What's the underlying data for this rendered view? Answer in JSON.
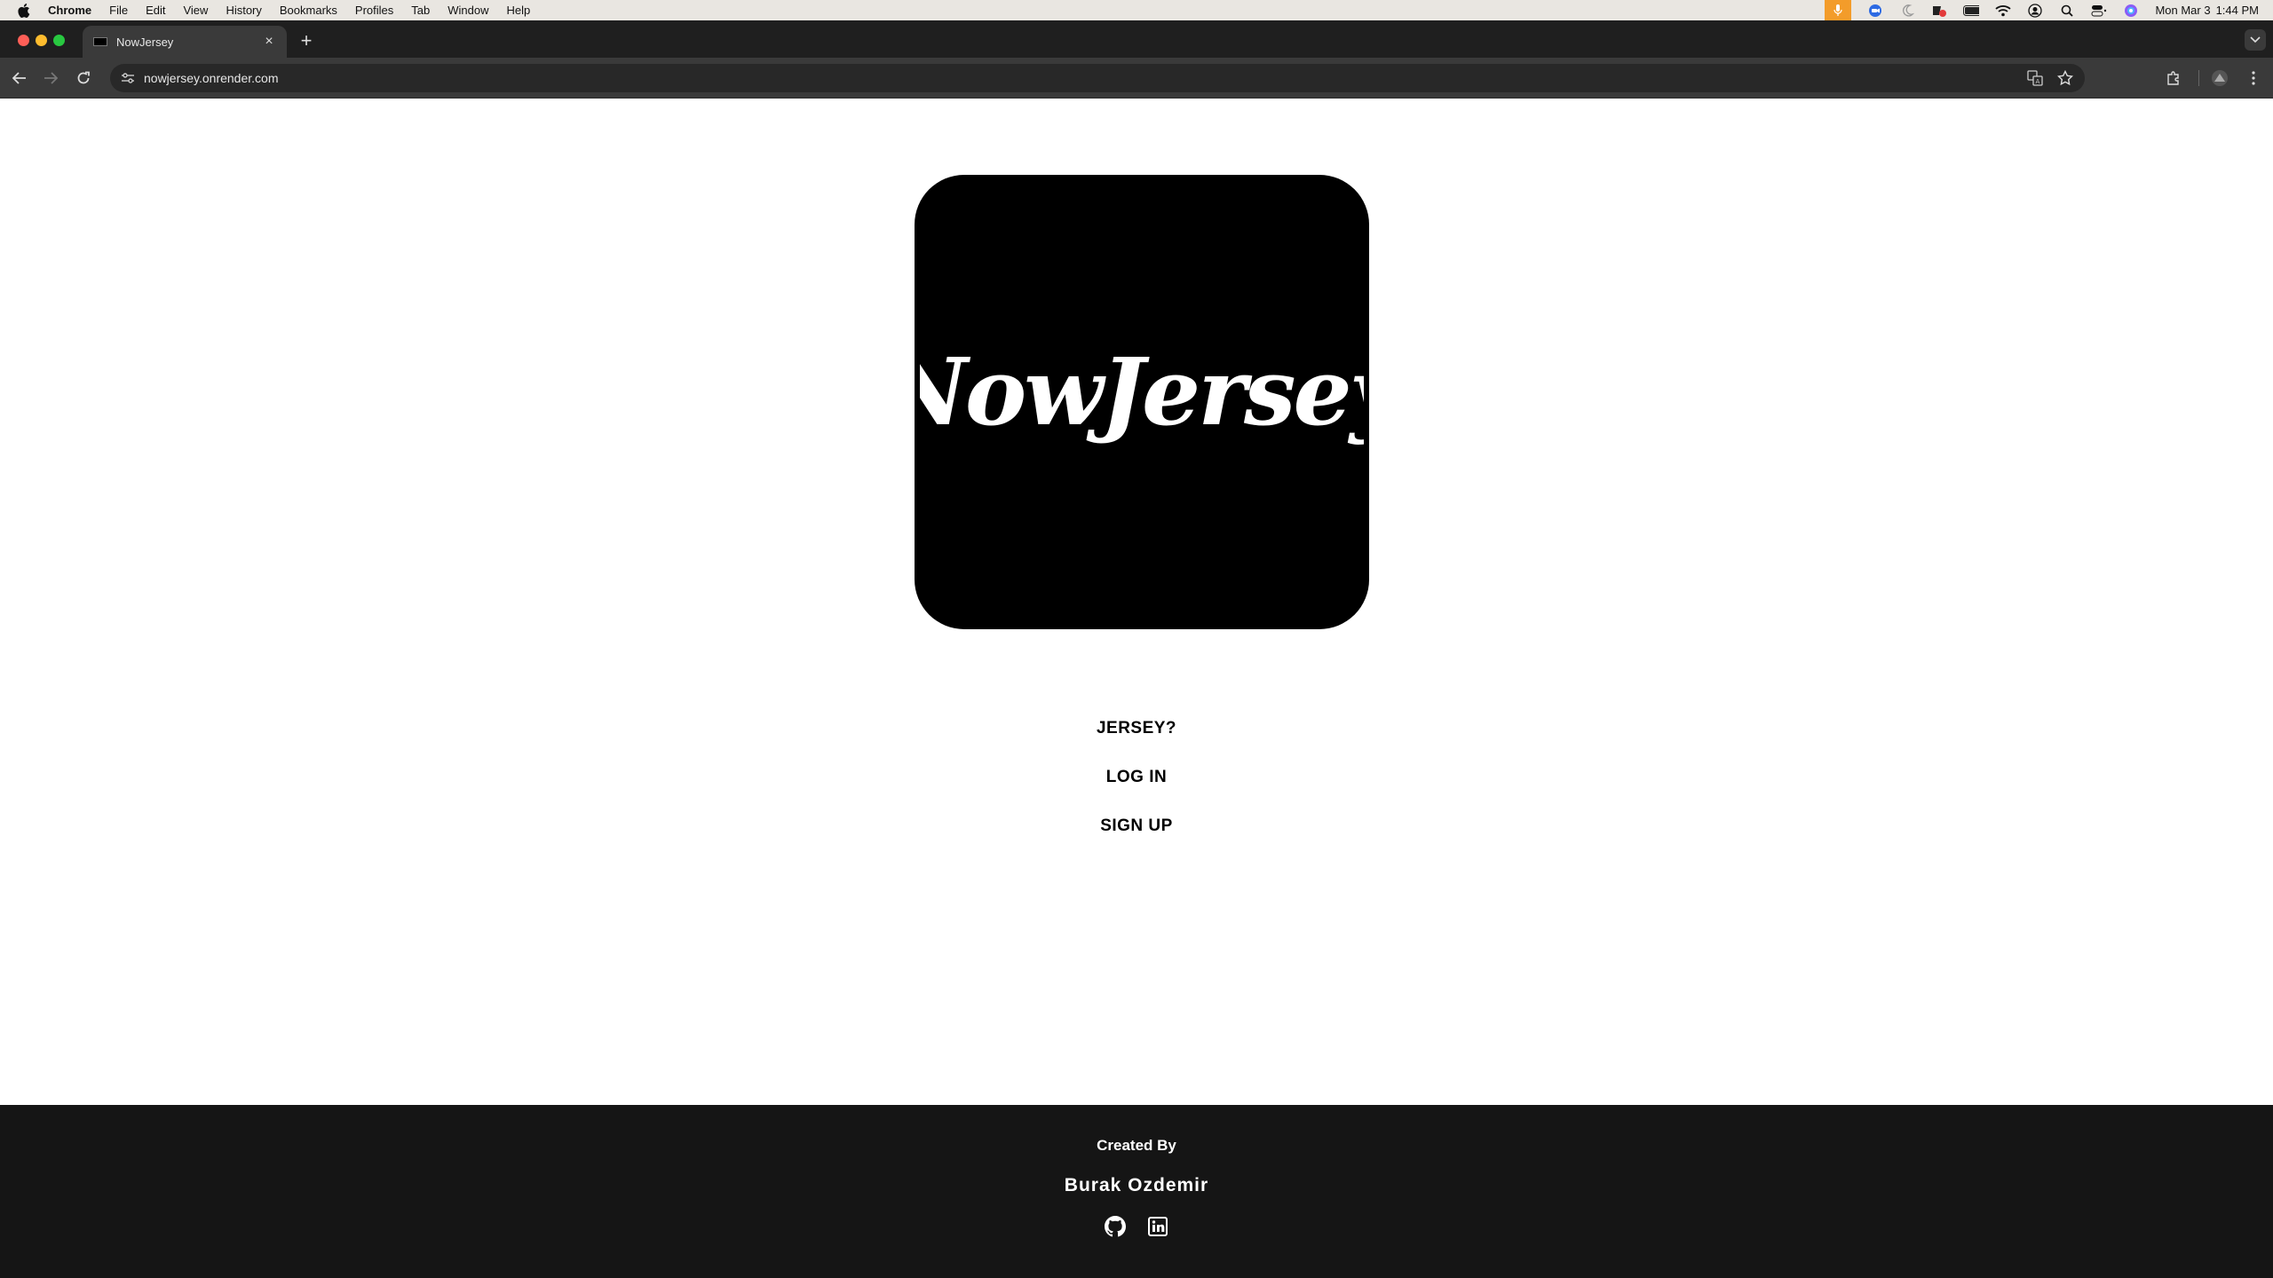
{
  "menubar": {
    "app": "Chrome",
    "items": [
      "File",
      "Edit",
      "View",
      "History",
      "Bookmarks",
      "Profiles",
      "Tab",
      "Window",
      "Help"
    ],
    "date": "Mon Mar 3",
    "time": "1:44 PM"
  },
  "browser": {
    "tab_title": "NowJersey",
    "url": "nowjersey.onrender.com"
  },
  "page": {
    "logo_text": "NowJersey",
    "links": [
      "JERSEY?",
      "LOG IN",
      "SIGN UP"
    ]
  },
  "footer": {
    "created_by": "Created By",
    "author": "Burak Ozdemir",
    "socials": [
      "github-icon",
      "linkedin-icon"
    ]
  },
  "colors": {
    "menubar_bg": "#e9e6e1",
    "tabstrip_bg": "#1f1f1f",
    "toolbar_bg": "#3a3a3a",
    "omnibox_bg": "#282828",
    "logo_bg": "#000000",
    "footer_bg": "#151515",
    "mic_indicator": "#f39c2a"
  }
}
